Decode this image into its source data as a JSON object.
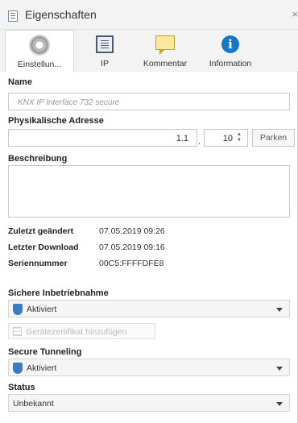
{
  "window": {
    "title": "Eigenschaften",
    "close_glyph": "×"
  },
  "tabs": [
    {
      "label": "Einstellun...",
      "icon": "gear-icon",
      "active": true
    },
    {
      "label": "IP",
      "icon": "ip-settings-icon",
      "active": false
    },
    {
      "label": "Kommentar",
      "icon": "comment-icon",
      "active": false
    },
    {
      "label": "Information",
      "icon": "info-icon",
      "active": false
    }
  ],
  "name": {
    "label": "Name",
    "placeholder": "KNX IP Interface 732 secure"
  },
  "address": {
    "label": "Physikalische Adresse",
    "prefix": "1.1",
    "separator": ".",
    "device": "10",
    "park_button": "Parken"
  },
  "description": {
    "label": "Beschreibung",
    "value": ""
  },
  "info": {
    "last_changed_label": "Zuletzt geändert",
    "last_changed_value": "07.05.2019 09:26",
    "last_download_label": "Letzter Download",
    "last_download_value": "07.05.2019 09:16",
    "serial_label": "Seriennummer",
    "serial_value": "00C5:FFFFDFE8"
  },
  "secure_commissioning": {
    "label": "Sichere Inbetriebnahme",
    "selected": "Aktiviert",
    "icon": "shield-icon"
  },
  "certificate": {
    "label": "Gerätezertifikat hinzufügen",
    "icon": "certificate-icon",
    "enabled": false
  },
  "secure_tunneling": {
    "label": "Secure Tunneling",
    "selected": "Aktiviert",
    "icon": "shield-icon"
  },
  "status": {
    "label": "Status",
    "selected": "Unbekannt"
  },
  "colors": {
    "accent_blue": "#1577c8",
    "shield_blue": "#3a7cc0",
    "comment_yellow": "#fde79a"
  }
}
